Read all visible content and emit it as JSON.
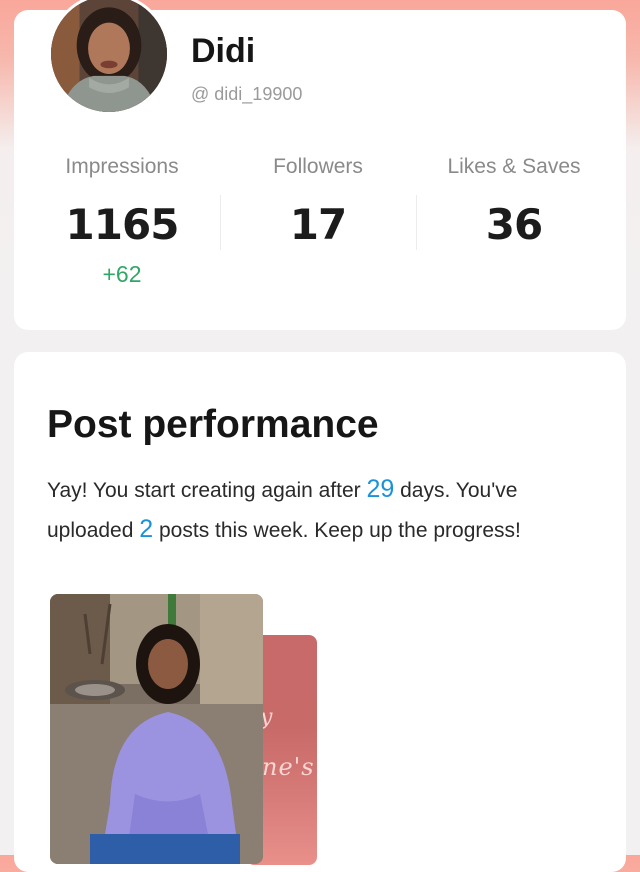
{
  "profile": {
    "name": "Didi",
    "handle": "@ didi_19900"
  },
  "stats": [
    {
      "label": "Impressions",
      "value": "1165",
      "delta": "+62"
    },
    {
      "label": "Followers",
      "value": "17",
      "delta": ""
    },
    {
      "label": "Likes & Saves",
      "value": "36",
      "delta": ""
    }
  ],
  "post_performance": {
    "title": "Post performance",
    "text_1": "Yay! You start creating again after ",
    "days": "29",
    "text_2": " days. You've",
    "text_3": "uploaded ",
    "posts": "2",
    "text_4": " posts this week. Keep up the progress!"
  },
  "thumbnails": {
    "second_partial_text": "ne's",
    "second_partial_mark": "y"
  },
  "colors": {
    "accent_blue": "#1b92d8",
    "delta_green": "#2fa866",
    "header_gradient": "#f9a79a"
  }
}
